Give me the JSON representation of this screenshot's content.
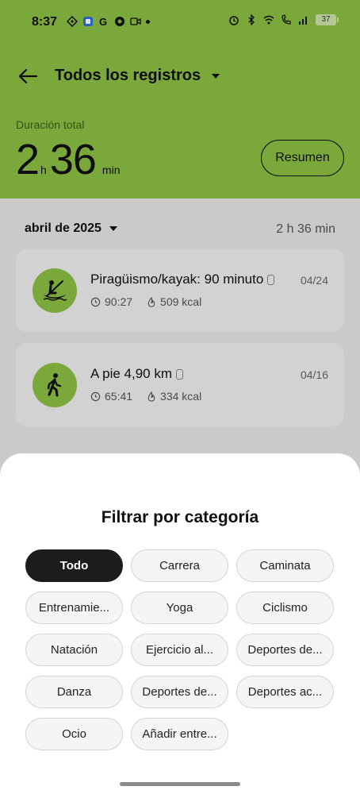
{
  "status_bar": {
    "time": "8:37",
    "battery": "37"
  },
  "header": {
    "title": "Todos los registros",
    "duration_label": "Duración total",
    "duration_hours": "2",
    "hours_unit": "h",
    "duration_minutes": "36",
    "minutes_unit": "min",
    "summary_button": "Resumen"
  },
  "month": {
    "label": "abril de 2025",
    "total": "2 h 36 min"
  },
  "activities": [
    {
      "name": "Piragüismo/kayak: 90 minuto",
      "date": "04/24",
      "time": "90:27",
      "kcal": "509 kcal",
      "icon": "kayak-icon"
    },
    {
      "name": "A pie 4,90 km",
      "date": "04/16",
      "time": "65:41",
      "kcal": "334 kcal",
      "icon": "walking-icon"
    }
  ],
  "sheet": {
    "title": "Filtrar por categoría",
    "chips": [
      "Todo",
      "Carrera",
      "Caminata",
      "Entrenamie...",
      "Yoga",
      "Ciclismo",
      "Natación",
      "Ejercicio al...",
      "Deportes de...",
      "Danza",
      "Deportes de...",
      "Deportes ac...",
      "Ocio",
      "Añadir entre..."
    ],
    "selected": "Todo"
  },
  "colors": {
    "accent": "#8dc043",
    "chip_selected": "#1c1c1c"
  }
}
